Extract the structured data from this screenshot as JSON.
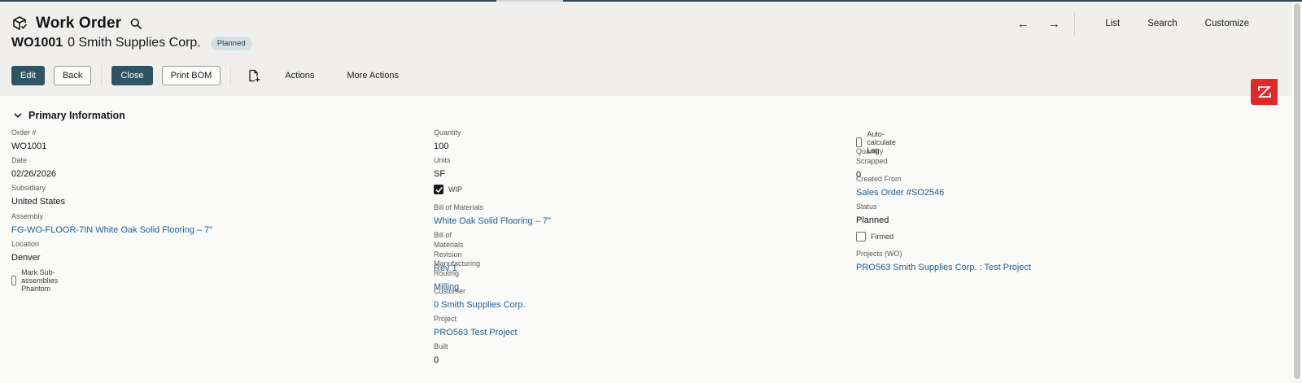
{
  "header": {
    "title": "Work Order",
    "record_id": "WO1001",
    "record_name": "0 Smith Supplies Corp.",
    "status": "Planned",
    "nav": {
      "prev": "←",
      "next": "→",
      "list": "List",
      "search": "Search",
      "customize": "Customize"
    }
  },
  "toolbar": {
    "edit": "Edit",
    "back": "Back",
    "close": "Close",
    "print_bom": "Print BOM",
    "actions": "Actions",
    "more_actions": "More Actions"
  },
  "section": {
    "title": "Primary Information"
  },
  "fields": {
    "order_num": {
      "label": "Order #",
      "value": "WO1001"
    },
    "date": {
      "label": "Date",
      "value": "02/26/2026"
    },
    "subsidiary": {
      "label": "Subsidiary",
      "value": "United States"
    },
    "assembly": {
      "label": "Assembly",
      "value": "FG-WO-FLOOR-7IN White Oak Solid Flooring – 7\""
    },
    "location": {
      "label": "Location",
      "value": "Denver"
    },
    "mark_phantom": {
      "label": "Mark Sub-assemblies Phantom",
      "checked": false
    },
    "quantity": {
      "label": "Quantity",
      "value": "100"
    },
    "units": {
      "label": "Units",
      "value": "SF"
    },
    "wip": {
      "label": "WIP",
      "checked": true
    },
    "bom": {
      "label": "Bill of Materials",
      "value": "White Oak Solid Flooring – 7\""
    },
    "bom_revision": {
      "label": "Bill of Materials Revision",
      "value": "Rev 1"
    },
    "routing": {
      "label": "Manufacturing Routing",
      "value": "Milling"
    },
    "customer": {
      "label": "Customer",
      "value": "0 Smith Supplies Corp."
    },
    "project": {
      "label": "Project",
      "value": "PRO563 Test Project"
    },
    "built": {
      "label": "Built",
      "value": "0"
    },
    "auto_lag": {
      "label": "Auto-calculate Lag",
      "checked": false
    },
    "qty_scrapped": {
      "label": "Quantity Scrapped",
      "value": "0"
    },
    "created_from": {
      "label": "Created From",
      "value": "Sales Order #SO2546"
    },
    "status": {
      "label": "Status",
      "value": "Planned"
    },
    "firmed": {
      "label": "Firmed",
      "checked": false
    },
    "projects_wo": {
      "label": "Projects (WO)",
      "value": "PRO563 Smith Supplies Corp. : Test Project"
    }
  },
  "colors": {
    "primary_button": "#2f5565",
    "link": "#1f5f8f",
    "badge_bg": "#d4e0e5",
    "ribbon": "#e02a2a"
  },
  "icons": [
    "work-order-icon",
    "search-icon",
    "arrow-left-icon",
    "arrow-right-icon",
    "new-document-icon",
    "chevron-down-icon",
    "collapse-ribbon-icon",
    "checkmark-icon"
  ]
}
